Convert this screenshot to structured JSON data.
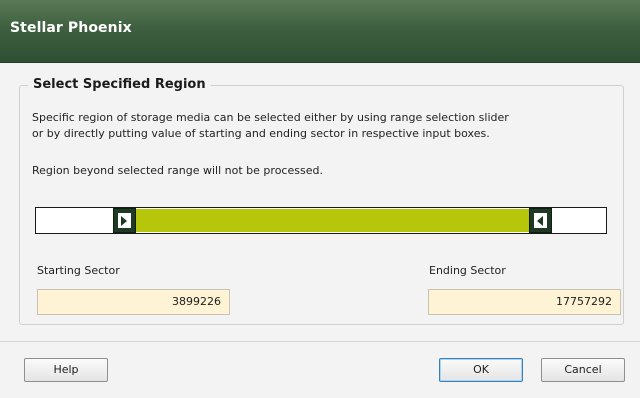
{
  "window": {
    "title": "Stellar Phoenix"
  },
  "group": {
    "title": "Select Specified Region",
    "description_line1": "Specific region of storage media can be selected either by using range selection slider",
    "description_line2": "or by directly putting value of starting and ending sector in respective input boxes.",
    "note": "Region beyond selected range will not be processed."
  },
  "slider": {
    "range_start_fraction": 0.175,
    "range_end_fraction": 0.865,
    "fill_color": "#b5c60b",
    "handle_color": "#1f3a24"
  },
  "fields": {
    "starting_label": "Starting Sector",
    "starting_value": "3899226",
    "ending_label": "Ending Sector",
    "ending_value": "17757292"
  },
  "buttons": {
    "help": "Help",
    "ok": "OK",
    "cancel": "Cancel"
  },
  "colors": {
    "titlebar": "#3f6040",
    "field_bg": "#fff3d5",
    "dialog_bg": "#f3f3f3"
  }
}
